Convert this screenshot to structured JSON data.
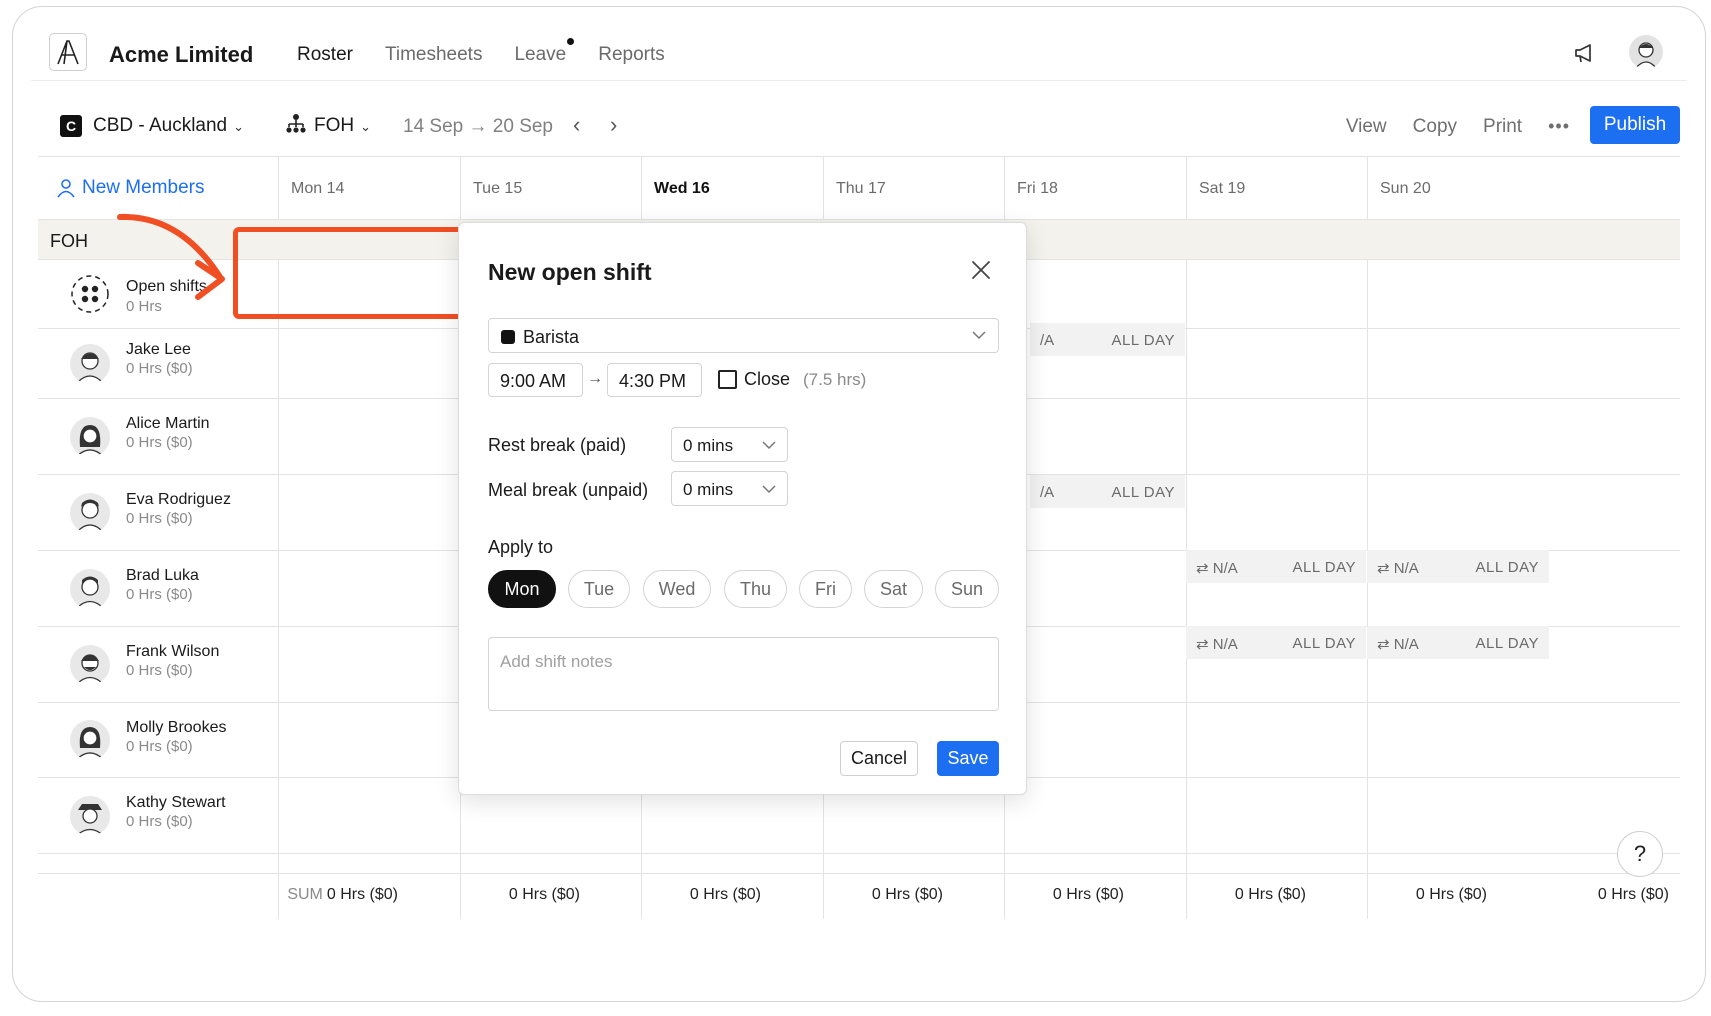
{
  "header": {
    "company": "Acme Limited",
    "nav": [
      "Roster",
      "Timesheets",
      "Leave",
      "Reports"
    ]
  },
  "toolbar": {
    "location_badge": "C",
    "location": "CBD - Auckland",
    "team": "FOH",
    "date_range": "14 Sep → 20 Sep",
    "view": "View",
    "copy": "Copy",
    "print": "Print",
    "more": "•••",
    "publish": "Publish"
  },
  "grid": {
    "new_members": "New Members",
    "days": [
      "Mon 14",
      "Tue 15",
      "Wed 16",
      "Thu 17",
      "Fri 18",
      "Sat 19",
      "Sun 20"
    ],
    "group": "FOH",
    "rows": [
      {
        "name": "Open shifts",
        "hrs": "0 Hrs"
      },
      {
        "name": "Jake Lee",
        "hrs": "0 Hrs ($0)"
      },
      {
        "name": "Alice Martin",
        "hrs": "0 Hrs ($0)"
      },
      {
        "name": "Eva Rodriguez",
        "hrs": "0 Hrs ($0)"
      },
      {
        "name": "Brad Luka",
        "hrs": "0 Hrs ($0)"
      },
      {
        "name": "Frank Wilson",
        "hrs": "0 Hrs ($0)"
      },
      {
        "name": "Molly Brookes",
        "hrs": "0 Hrs ($0)"
      },
      {
        "name": "Kathy Stewart",
        "hrs": "0 Hrs ($0)"
      }
    ],
    "na_text": "N/A",
    "na_partial": "/A",
    "all_day": "ALL DAY",
    "sum_label": "SUM",
    "totals": [
      "0 Hrs ($0)",
      "0 Hrs ($0)",
      "0 Hrs ($0)",
      "0 Hrs ($0)",
      "0 Hrs ($0)",
      "0 Hrs ($0)",
      "0 Hrs ($0)",
      "0 Hrs ($0)"
    ],
    "help": "?"
  },
  "modal": {
    "title": "New open shift",
    "role": "Barista",
    "start_time": "9:00 AM",
    "end_time": "4:30 PM",
    "close_label": "Close",
    "duration": "(7.5 hrs)",
    "rest_break_label": "Rest break (paid)",
    "rest_break_value": "0 mins",
    "meal_break_label": "Meal break (unpaid)",
    "meal_break_value": "0 mins",
    "apply_to_label": "Apply to",
    "days": [
      "Mon",
      "Tue",
      "Wed",
      "Thu",
      "Fri",
      "Sat",
      "Sun"
    ],
    "active_day": "Mon",
    "notes_placeholder": "Add shift notes",
    "cancel": "Cancel",
    "save": "Save"
  },
  "colors": {
    "accent": "#1d6ff2",
    "annotation": "#f04e23",
    "group_bar": "#f3f2ec"
  }
}
